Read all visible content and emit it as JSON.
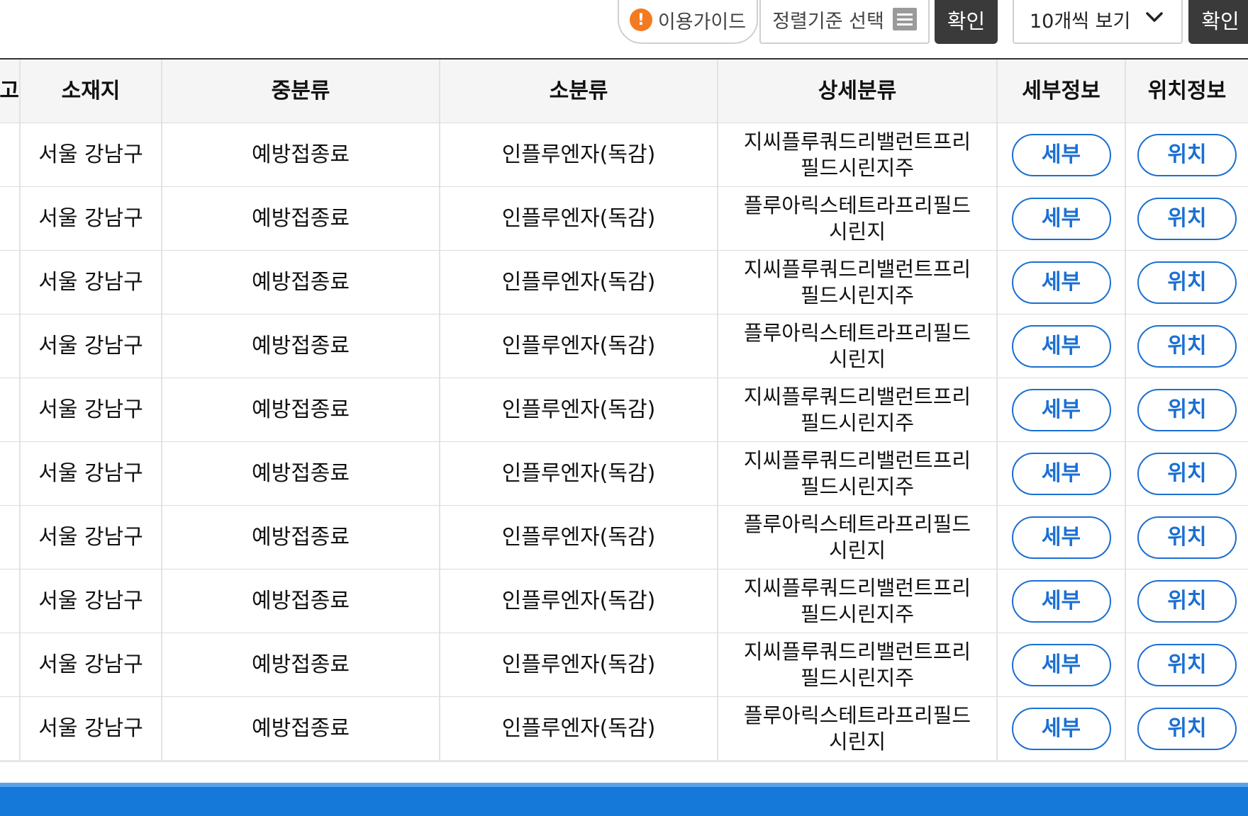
{
  "toolbar": {
    "guide_label": "이용가이드",
    "sort_label": "정렬기준 선택",
    "confirm_label": "확인",
    "per_page_value": "10개씩 보기",
    "confirm2_label": "확인"
  },
  "table": {
    "headers": {
      "partial": "고",
      "location": "소재지",
      "mid_category": "중분류",
      "sub_category": "소분류",
      "detail_category": "상세분류",
      "detail_info": "세부정보",
      "location_info": "위치정보"
    },
    "rows": [
      {
        "location": "서울 강남구",
        "mid": "예방접종료",
        "sub": "인플루엔자(독감)",
        "detail_line1": "지씨플루쿼드리밸런트프리",
        "detail_line2": "필드시린지주",
        "detail_btn": "세부",
        "loc_btn": "위치"
      },
      {
        "location": "서울 강남구",
        "mid": "예방접종료",
        "sub": "인플루엔자(독감)",
        "detail_line1": "플루아릭스테트라프리필드",
        "detail_line2": "시린지",
        "detail_btn": "세부",
        "loc_btn": "위치"
      },
      {
        "location": "서울 강남구",
        "mid": "예방접종료",
        "sub": "인플루엔자(독감)",
        "detail_line1": "지씨플루쿼드리밸런트프리",
        "detail_line2": "필드시린지주",
        "detail_btn": "세부",
        "loc_btn": "위치"
      },
      {
        "location": "서울 강남구",
        "mid": "예방접종료",
        "sub": "인플루엔자(독감)",
        "detail_line1": "플루아릭스테트라프리필드",
        "detail_line2": "시린지",
        "detail_btn": "세부",
        "loc_btn": "위치"
      },
      {
        "location": "서울 강남구",
        "mid": "예방접종료",
        "sub": "인플루엔자(독감)",
        "detail_line1": "지씨플루쿼드리밸런트프리",
        "detail_line2": "필드시린지주",
        "detail_btn": "세부",
        "loc_btn": "위치"
      },
      {
        "location": "서울 강남구",
        "mid": "예방접종료",
        "sub": "인플루엔자(독감)",
        "detail_line1": "지씨플루쿼드리밸런트프리",
        "detail_line2": "필드시린지주",
        "detail_btn": "세부",
        "loc_btn": "위치"
      },
      {
        "location": "서울 강남구",
        "mid": "예방접종료",
        "sub": "인플루엔자(독감)",
        "detail_line1": "플루아릭스테트라프리필드",
        "detail_line2": "시린지",
        "detail_btn": "세부",
        "loc_btn": "위치"
      },
      {
        "location": "서울 강남구",
        "mid": "예방접종료",
        "sub": "인플루엔자(독감)",
        "detail_line1": "지씨플루쿼드리밸런트프리",
        "detail_line2": "필드시린지주",
        "detail_btn": "세부",
        "loc_btn": "위치"
      },
      {
        "location": "서울 강남구",
        "mid": "예방접종료",
        "sub": "인플루엔자(독감)",
        "detail_line1": "지씨플루쿼드리밸런트프리",
        "detail_line2": "필드시린지주",
        "detail_btn": "세부",
        "loc_btn": "위치"
      },
      {
        "location": "서울 강남구",
        "mid": "예방접종료",
        "sub": "인플루엔자(독감)",
        "detail_line1": "플루아릭스테트라프리필드",
        "detail_line2": "시린지",
        "detail_btn": "세부",
        "loc_btn": "위치"
      }
    ]
  },
  "colors": {
    "accent_blue": "#1a6fd1",
    "dark_button": "#3a3a3a",
    "footer_blue": "#1479d8",
    "warning_orange": "#f47a1f"
  }
}
